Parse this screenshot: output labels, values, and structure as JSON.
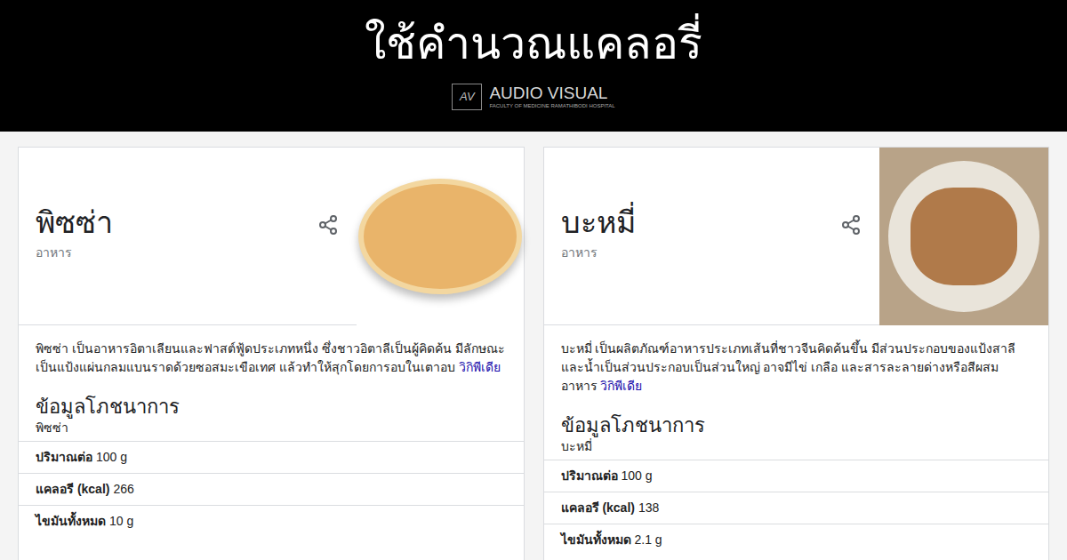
{
  "header": {
    "title": "ใช้คำนวณแคลอรี่",
    "logo": {
      "mark": "AV",
      "name": "AUDIO VISUAL",
      "subtitle": "FACULTY OF MEDICINE RAMATHIBODI HOSPITAL"
    }
  },
  "cards": [
    {
      "title": "พิซซ่า",
      "category": "อาหาร",
      "description": "พิซซ่า เป็นอาหารอิตาเลียนและฟาสต์ฟู้ดประเภทหนึ่ง ซึ่งชาวอิตาลีเป็นผู้คิดค้น มีลักษณะเป็นแป้งแผ่นกลมแบนราดด้วยซอสมะเขือเทศ แล้วทำให้สุกโดยการอบในเตาอบ",
      "source": "วิกิพีเดีย",
      "nutrition": {
        "heading": "ข้อมูลโภชนาการ",
        "subject": "พิซซ่า",
        "rows": [
          {
            "label": "ปริมาณต่อ",
            "value": "100 g"
          },
          {
            "label": "แคลอรี (kcal)",
            "value": "266"
          },
          {
            "label": "ไขมันทั้งหมด",
            "value": "10 g"
          }
        ]
      }
    },
    {
      "title": "บะหมี่",
      "category": "อาหาร",
      "description": "บะหมี่ เป็นผลิตภัณฑ์อาหารประเภทเส้นที่ชาวจีนคิดค้นขึ้น มีส่วนประกอบของแป้งสาลี และน้ำเป็นส่วนประกอบเป็นส่วนใหญ่ อาจมีไข่ เกลือ และสารละลายด่างหรือสีผสมอาหาร",
      "source": "วิกิพีเดีย",
      "nutrition": {
        "heading": "ข้อมูลโภชนาการ",
        "subject": "บะหมี่",
        "rows": [
          {
            "label": "ปริมาณต่อ",
            "value": "100 g"
          },
          {
            "label": "แคลอรี (kcal)",
            "value": "138"
          },
          {
            "label": "ไขมันทั้งหมด",
            "value": "2.1 g"
          }
        ]
      }
    }
  ]
}
